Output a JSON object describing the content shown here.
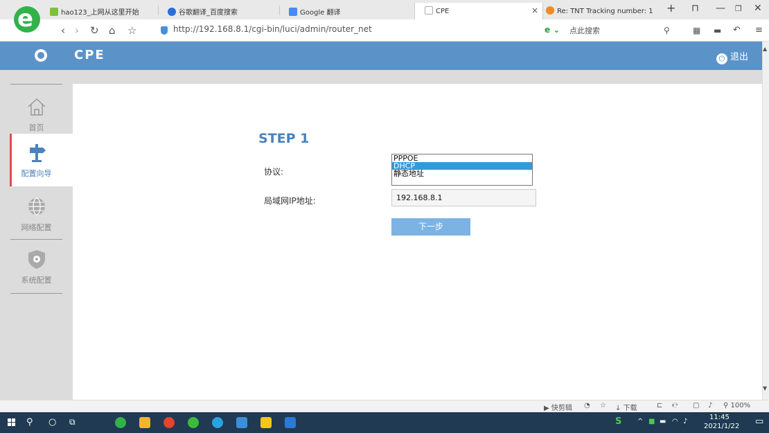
{
  "browser": {
    "tabs": [
      {
        "title": "hao123_上网从这里开始",
        "color": "#7fbf3f"
      },
      {
        "title": "谷歌翻译_百度搜索",
        "color": "#2a6fdb"
      },
      {
        "title": "Google 翻译",
        "color": "#4a8af4"
      },
      {
        "title": "CPE",
        "color": "#bbbbbb"
      },
      {
        "title": "Re: TNT Tracking number: 1",
        "color": "#f08a24"
      }
    ],
    "tab_close": "×",
    "new_tab": "+",
    "url": "http://192.168.8.1/cgi-bin/luci/admin/router_net",
    "search_hint": "点此搜索",
    "search_engine_icon": "e-icon"
  },
  "header": {
    "title": "CPE",
    "logout_label": "退出",
    "accent_color": "#5b93c8"
  },
  "sidebar": {
    "items": [
      {
        "label": "首页",
        "icon": "home-icon"
      },
      {
        "label": "配置向导",
        "icon": "signpost-icon",
        "active": true
      },
      {
        "label": "网络配置",
        "icon": "globe-icon"
      },
      {
        "label": "系统配置",
        "icon": "shield-gear-icon"
      }
    ]
  },
  "form": {
    "step_title": "STEP 1",
    "protocol_label": "协议:",
    "protocol_options": [
      "PPPOE",
      "DHCP",
      "静态地址"
    ],
    "protocol_selected": "DHCP",
    "lan_ip_label": "局域网IP地址:",
    "lan_ip_value": "192.168.8.1",
    "next_label": "下一步"
  },
  "statusbar": {
    "clip_label": "快剪辑",
    "download_label": "下载",
    "zoom": "100%"
  },
  "taskbar": {
    "time": "11:45",
    "date": "2021/1/22"
  }
}
